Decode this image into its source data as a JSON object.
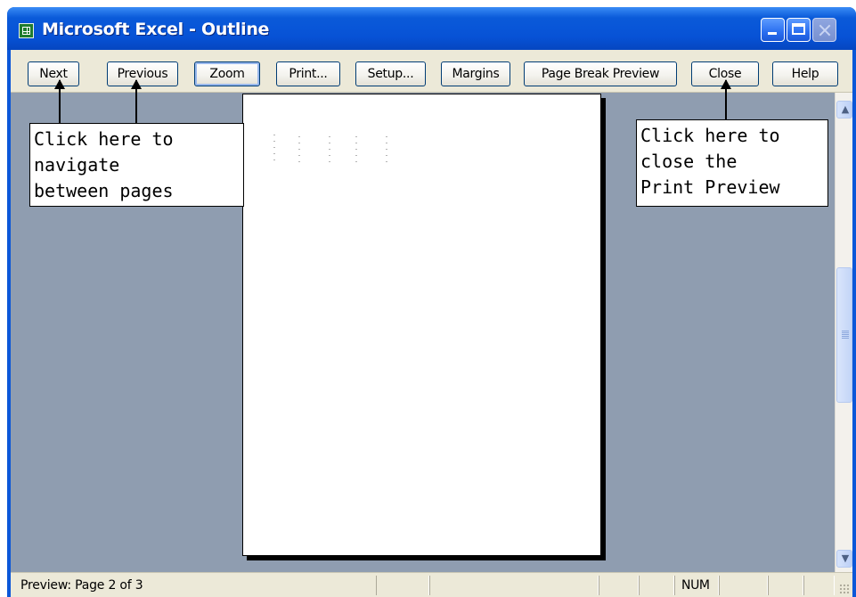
{
  "window": {
    "title": "Microsoft Excel - Outline",
    "icon": "excel-icon"
  },
  "toolbar": {
    "buttons": [
      {
        "label": "Next"
      },
      {
        "label": "Previous"
      },
      {
        "label": "Zoom"
      },
      {
        "label": "Print..."
      },
      {
        "label": "Setup..."
      },
      {
        "label": "Margins"
      },
      {
        "label": "Page Break Preview"
      },
      {
        "label": "Close"
      },
      {
        "label": "Help"
      }
    ]
  },
  "preview": {
    "background_color": "#8f9db0"
  },
  "callouts": {
    "navigate": "Click here to\nnavigate\nbetween pages",
    "close": "Click here to\nclose the\nPrint Preview"
  },
  "statusbar": {
    "text": "Preview: Page 2 of 3",
    "num": "NUM"
  },
  "colors": {
    "title_bar": "#0752d6",
    "button_border": "#003c74",
    "chrome": "#ece9d8"
  }
}
